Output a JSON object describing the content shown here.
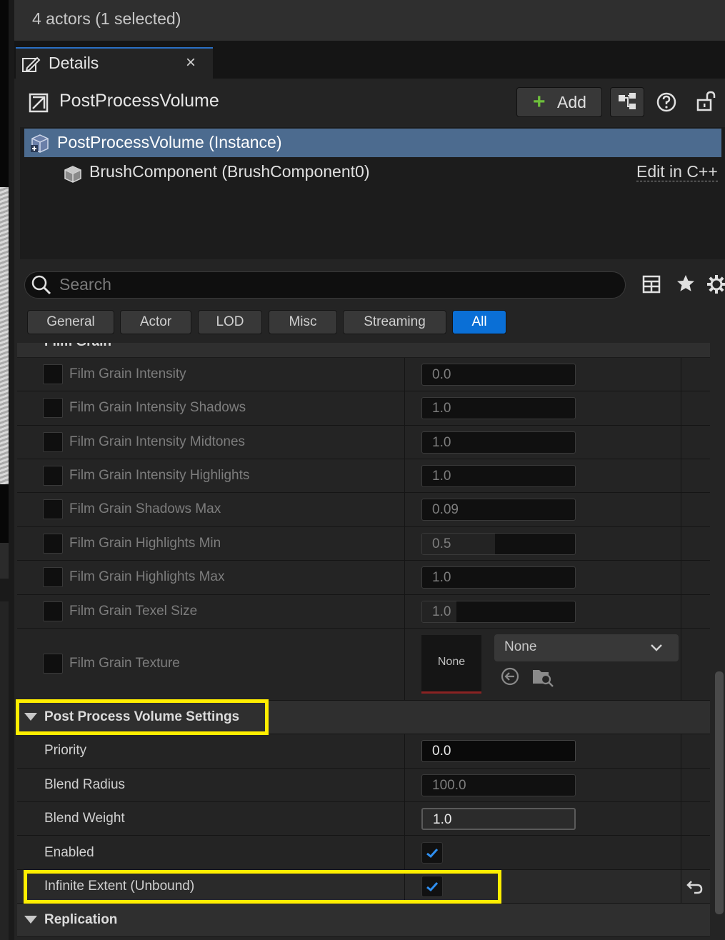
{
  "outliner": {
    "status": "4 actors (1 selected)"
  },
  "tab": {
    "title": "Details"
  },
  "header": {
    "actor_name": "PostProcessVolume",
    "add_label": "Add"
  },
  "components": [
    {
      "label": "PostProcessVolume (Instance)"
    },
    {
      "label": "BrushComponent (BrushComponent0)",
      "action": "Edit in C++"
    }
  ],
  "search": {
    "placeholder": "Search"
  },
  "filters": [
    "General",
    "Actor",
    "LOD",
    "Misc",
    "Streaming",
    "All"
  ],
  "active_filter": "All",
  "film_grain": {
    "category": "Film Grain",
    "rows": [
      {
        "label": "Film Grain Intensity",
        "value": "0.0"
      },
      {
        "label": "Film Grain Intensity Shadows",
        "value": "1.0"
      },
      {
        "label": "Film Grain Intensity Midtones",
        "value": "1.0"
      },
      {
        "label": "Film Grain Intensity Highlights",
        "value": "1.0"
      },
      {
        "label": "Film Grain Shadows Max",
        "value": "0.09"
      },
      {
        "label": "Film Grain Highlights Min",
        "value": "0.5"
      },
      {
        "label": "Film Grain Highlights Max",
        "value": "1.0"
      },
      {
        "label": "Film Grain Texel Size",
        "value": "1.0"
      }
    ],
    "texture": {
      "label": "Film Grain Texture",
      "thumb_text": "None",
      "selected": "None"
    }
  },
  "ppv_settings": {
    "category": "Post Process Volume Settings",
    "rows": [
      {
        "label": "Priority",
        "value": "0.0"
      },
      {
        "label": "Blend Radius",
        "value": "100.0"
      },
      {
        "label": "Blend Weight",
        "value": "1.0"
      },
      {
        "label": "Enabled",
        "checked": true
      },
      {
        "label": "Infinite Extent (Unbound)",
        "checked": true
      }
    ]
  },
  "replication": {
    "category": "Replication"
  },
  "colors": {
    "accent": "#0a6fd6",
    "selection": "#4c6b8f",
    "highlight": "#ffee00",
    "add_plus": "#6dbf3b"
  }
}
